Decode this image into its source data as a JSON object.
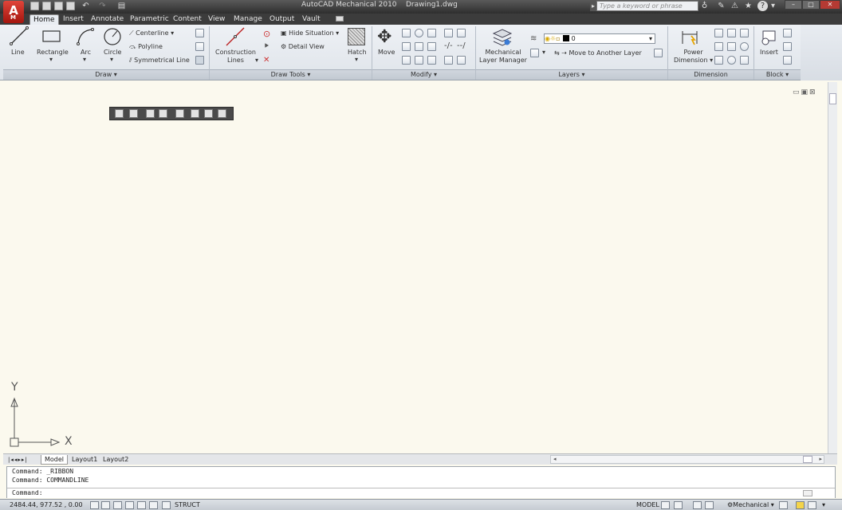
{
  "app": {
    "title": "AutoCAD Mechanical 2010",
    "document": "Drawing1.dwg",
    "logo_letter": "A",
    "logo_sub": "M"
  },
  "search": {
    "placeholder": "Type a keyword or phrase"
  },
  "tabs": [
    "Home",
    "Insert",
    "Annotate",
    "Parametric",
    "Content",
    "View",
    "Manage",
    "Output",
    "Vault"
  ],
  "draw": {
    "line": "Line",
    "rectangle": "Rectangle",
    "arc": "Arc",
    "circle": "Circle",
    "centerline": "Centerline",
    "polyline": "Polyline",
    "symmetrical_line": "Symmetrical Line",
    "panel": "Draw"
  },
  "draw_tools": {
    "construction_lines": "Construction Lines",
    "construction_line1": "Construction",
    "construction_line2": "Lines",
    "hide_situation": "Hide Situation",
    "detail_view": "Detail View",
    "hatch": "Hatch",
    "panel": "Draw Tools"
  },
  "modify": {
    "move": "Move",
    "panel": "Modify"
  },
  "layers": {
    "manager_line1": "Mechanical",
    "manager_line2": "Layer Manager",
    "current_layer": "0",
    "move_to_layer": "Move to Another Layer",
    "panel": "Layers"
  },
  "dimension": {
    "power_line1": "Power",
    "power_line2": "Dimension",
    "panel": "Dimension"
  },
  "block": {
    "insert": "Insert",
    "panel": "Block"
  },
  "layout_tabs": [
    "Model",
    "Layout1",
    "Layout2"
  ],
  "ucs": {
    "x": "X",
    "y": "Y"
  },
  "command": {
    "line1": "Command:  _RIBBON",
    "line2": "Command: COMMANDLINE",
    "prompt": "Command:"
  },
  "status": {
    "coords": "2484.44, 977.52 , 0.00",
    "struct": "STRUCT",
    "model": "MODEL",
    "workspace": "Mechanical"
  },
  "colors": {
    "canvas": "#fbf9ee",
    "accent": "#c4241b",
    "ribbon": "#e3e8ee"
  }
}
